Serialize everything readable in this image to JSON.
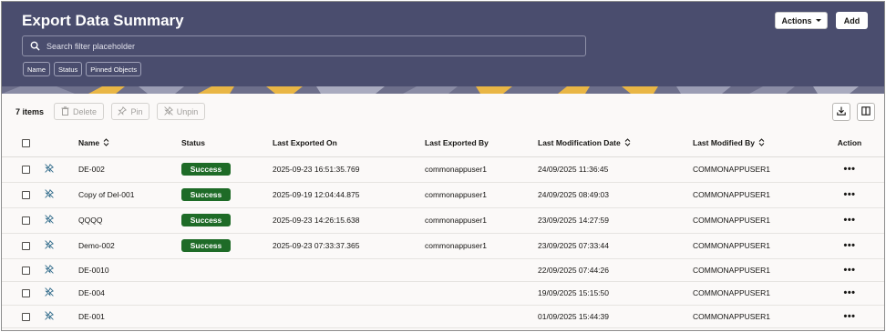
{
  "header": {
    "title": "Export Data Summary",
    "actions_label": "Actions",
    "add_label": "Add",
    "search_placeholder": "Search filter placeholder",
    "filters": [
      "Name",
      "Status",
      "Pinned Objects"
    ]
  },
  "toolbar": {
    "count": "7 items",
    "delete_label": "Delete",
    "pin_label": "Pin",
    "unpin_label": "Unpin"
  },
  "table": {
    "columns": [
      "Name",
      "Status",
      "Last Exported On",
      "Last Exported By",
      "Last Modification Date",
      "Last Modified By",
      "Action"
    ],
    "rows": [
      {
        "name": "DE-002",
        "status": "Success",
        "exported_on": "2025-09-23 16:51:35.769",
        "exported_by": "commonappuser1",
        "mod_date": "24/09/2025 11:36:45",
        "mod_by": "COMMONAPPUSER1",
        "action": "•••"
      },
      {
        "name": "Copy of Del-001",
        "status": "Success",
        "exported_on": "2025-09-19 12:04:44.875",
        "exported_by": "commonappuser1",
        "mod_date": "24/09/2025 08:49:03",
        "mod_by": "COMMONAPPUSER1",
        "action": "•••"
      },
      {
        "name": "QQQQ",
        "status": "Success",
        "exported_on": "2025-09-23 14:26:15.638",
        "exported_by": "commonappuser1",
        "mod_date": "23/09/2025 14:27:59",
        "mod_by": "COMMONAPPUSER1",
        "action": "•••"
      },
      {
        "name": "Demo-002",
        "status": "Success",
        "exported_on": "2025-09-23 07:33:37.365",
        "exported_by": "commonappuser1",
        "mod_date": "23/09/2025 07:33:44",
        "mod_by": "COMMONAPPUSER1",
        "action": "•••"
      },
      {
        "name": "DE-0010",
        "status": "",
        "exported_on": "",
        "exported_by": "",
        "mod_date": "22/09/2025 07:44:26",
        "mod_by": "COMMONAPPUSER1",
        "action": "•••"
      },
      {
        "name": "DE-004",
        "status": "",
        "exported_on": "",
        "exported_by": "",
        "mod_date": "19/09/2025 15:15:50",
        "mod_by": "COMMONAPPUSER1",
        "action": "•••"
      },
      {
        "name": "DE-001",
        "status": "",
        "exported_on": "",
        "exported_by": "",
        "mod_date": "01/09/2025 15:44:39",
        "mod_by": "COMMONAPPUSER1",
        "action": "•••"
      }
    ]
  },
  "colors": {
    "header_bg": "#4a4d6e",
    "success": "#1e6b27",
    "pin_icon": "#2f6a8a"
  },
  "icons": [
    "search-icon",
    "caret-down-icon",
    "delete-icon",
    "pin-icon",
    "unpin-icon",
    "download-icon",
    "columns-icon",
    "sort-icon",
    "unpinned-row-icon",
    "more-actions-icon"
  ]
}
